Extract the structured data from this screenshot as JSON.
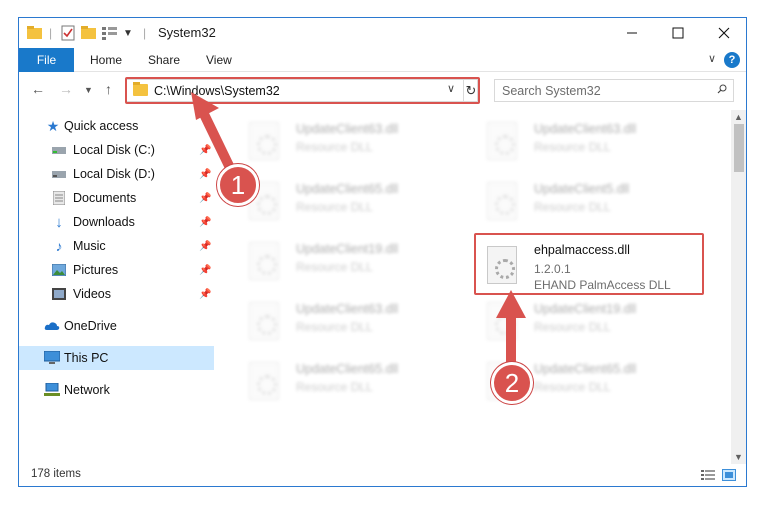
{
  "window": {
    "title": "System32",
    "caption_buttons": [
      "minimize-icon",
      "maximize-icon",
      "close-icon"
    ]
  },
  "ribbon": {
    "file_label": "File",
    "tabs": [
      "Home",
      "Share",
      "View"
    ],
    "help_label": "?"
  },
  "navbar": {
    "address": "C:\\Windows\\System32",
    "search_placeholder": "Search System32"
  },
  "sidebar": {
    "items": [
      {
        "label": "Quick access",
        "icon": "star-icon"
      },
      {
        "label": "Local Disk (C:)",
        "icon": "drive-icon"
      },
      {
        "label": "Local Disk (D:)",
        "icon": "drive-icon"
      },
      {
        "label": "Documents",
        "icon": "documents-icon"
      },
      {
        "label": "Downloads",
        "icon": "download-icon"
      },
      {
        "label": "Music",
        "icon": "music-icon"
      },
      {
        "label": "Pictures",
        "icon": "pictures-icon"
      },
      {
        "label": "Videos",
        "icon": "videos-icon"
      },
      {
        "label": "OneDrive",
        "icon": "cloud-icon"
      },
      {
        "label": "This PC",
        "icon": "computer-icon"
      },
      {
        "label": "Network",
        "icon": "network-icon"
      }
    ]
  },
  "files": [
    {
      "name": "UpdateClient63.dll",
      "desc": "Resource DLL"
    },
    {
      "name": "UpdateClient63.dll",
      "desc": "Resource DLL"
    },
    {
      "name": "UpdateClient65.dll",
      "desc": "Resource DLL"
    },
    {
      "name": "UpdateClient5.dll",
      "desc": "Resource DLL"
    },
    {
      "name": "UpdateClient19.dll",
      "desc": "Resource DLL"
    },
    {
      "name": "UpdateClient63.dll",
      "desc": "Resource DLL"
    },
    {
      "name": "UpdateClient19.dll",
      "desc": "Resource DLL"
    },
    {
      "name": "UpdateClient65.dll",
      "desc": "Resource DLL"
    },
    {
      "name": "UpdateClient65.dll",
      "desc": "Resource DLL"
    }
  ],
  "target_file": {
    "name": "ehpalmaccess.dll",
    "version": "1.2.0.1",
    "company": "EHAND PalmAccess  DLL"
  },
  "status": {
    "items_count": "178 items"
  },
  "annotations": {
    "step1": "1",
    "step2": "2",
    "color": "#d9534f"
  }
}
